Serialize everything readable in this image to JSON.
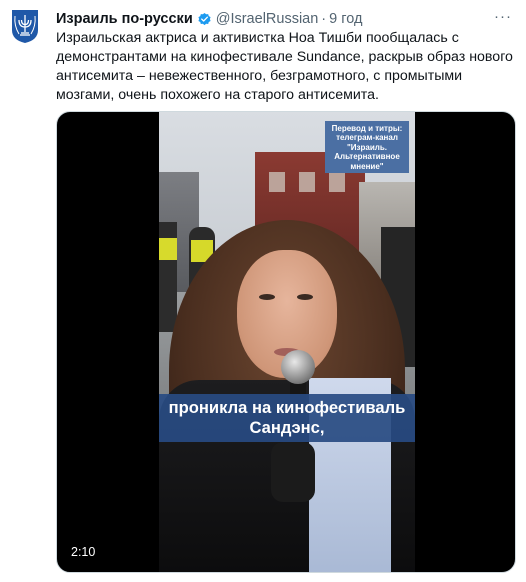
{
  "tweet": {
    "display_name": "Израиль по-русски",
    "handle": "@IsraelRussian",
    "separator": "·",
    "time": "9 год",
    "more_glyph": "···",
    "text": "Израильская актриса и активистка Ноа Тишби пообщалась с демонстрантами на кинофестивале Sundance, раскрыв образ нового антисемита – невежественного, безграмотного, с промытыми мозгами, очень похожего на старого антисемита."
  },
  "video": {
    "credit": "Перевод и титры: телеграм-канал \"Израиль. Альтернативное мнение\"",
    "caption": "проникла на кинофестиваль Сандэнс,",
    "duration": "2:10"
  },
  "colors": {
    "accent": "#1d9bf0",
    "text_primary": "#0f1419",
    "text_secondary": "#536471",
    "caption_bg": "#284b82",
    "logo_blue": "#1f58a8"
  },
  "icons": {
    "avatar": "israel-emblem-icon",
    "verified": "verified-badge-icon",
    "more": "more-horizontal-icon"
  }
}
